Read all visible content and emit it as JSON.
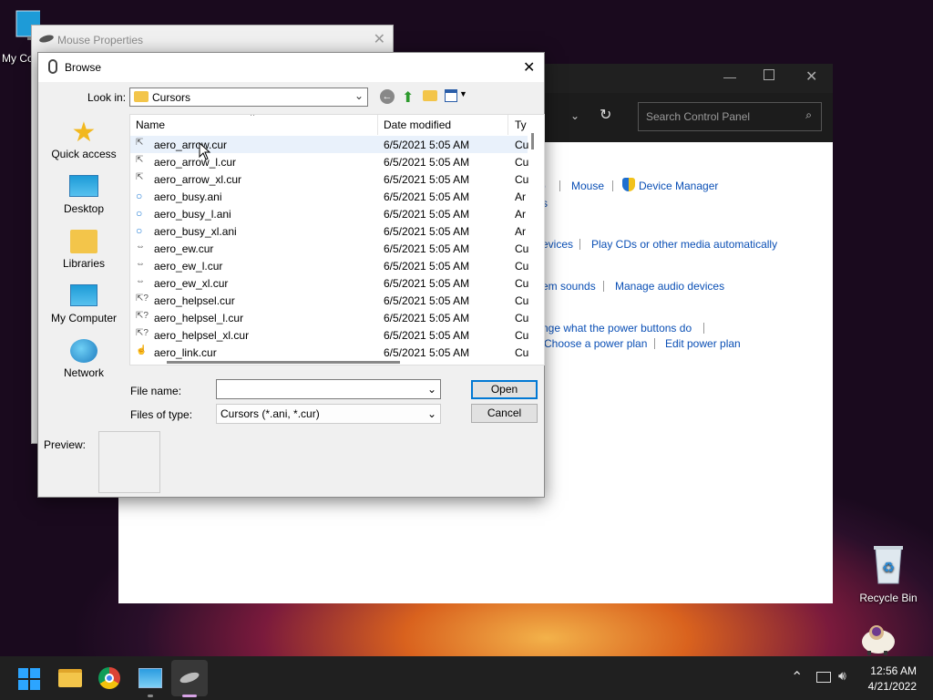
{
  "desktop": {
    "icons": [
      {
        "label": "My Co",
        "icon": "monitor-icon"
      },
      {
        "label": "Recycle Bin",
        "icon": "recycle-bin-icon"
      }
    ]
  },
  "control_panel": {
    "search_placeholder": "Search Control Panel",
    "links": {
      "p": "p",
      "mouse": "Mouse",
      "device_manager": "Device Manager",
      "s": "s",
      "evices": "evices",
      "play_cds": "Play CDs or other media automatically",
      "em_sounds": "em sounds",
      "manage_audio": "Manage audio devices",
      "power_buttons": "nge what the power buttons do",
      "choose_power_plan": "Choose a power plan",
      "edit_power_plan": "Edit power plan"
    }
  },
  "mouse_properties": {
    "title": "Mouse Properties"
  },
  "browse": {
    "title": "Browse",
    "look_in_label": "Look in:",
    "look_in_value": "Cursors",
    "places": [
      {
        "label": "Quick access",
        "icon": "star-icon"
      },
      {
        "label": "Desktop",
        "icon": "desktop-icon"
      },
      {
        "label": "Libraries",
        "icon": "libraries-icon"
      },
      {
        "label": "My Computer",
        "icon": "computer-icon"
      },
      {
        "label": "Network",
        "icon": "network-icon"
      }
    ],
    "columns": {
      "name": "Name",
      "date": "Date modified",
      "type": "Ty"
    },
    "files": [
      {
        "name": "aero_arrow.cur",
        "date": "6/5/2021 5:05 AM",
        "type": "Cu",
        "icon": "arrow-cursor-icon"
      },
      {
        "name": "aero_arrow_l.cur",
        "date": "6/5/2021 5:05 AM",
        "type": "Cu",
        "icon": "arrow-cursor-icon"
      },
      {
        "name": "aero_arrow_xl.cur",
        "date": "6/5/2021 5:05 AM",
        "type": "Cu",
        "icon": "arrow-cursor-icon"
      },
      {
        "name": "aero_busy.ani",
        "date": "6/5/2021 5:05 AM",
        "type": "Ar",
        "icon": "busy-cursor-icon"
      },
      {
        "name": "aero_busy_l.ani",
        "date": "6/5/2021 5:05 AM",
        "type": "Ar",
        "icon": "busy-cursor-icon"
      },
      {
        "name": "aero_busy_xl.ani",
        "date": "6/5/2021 5:05 AM",
        "type": "Ar",
        "icon": "busy-cursor-icon"
      },
      {
        "name": "aero_ew.cur",
        "date": "6/5/2021 5:05 AM",
        "type": "Cu",
        "icon": "ew-cursor-icon"
      },
      {
        "name": "aero_ew_l.cur",
        "date": "6/5/2021 5:05 AM",
        "type": "Cu",
        "icon": "ew-cursor-icon"
      },
      {
        "name": "aero_ew_xl.cur",
        "date": "6/5/2021 5:05 AM",
        "type": "Cu",
        "icon": "ew-cursor-icon"
      },
      {
        "name": "aero_helpsel.cur",
        "date": "6/5/2021 5:05 AM",
        "type": "Cu",
        "icon": "helpsel-cursor-icon"
      },
      {
        "name": "aero_helpsel_l.cur",
        "date": "6/5/2021 5:05 AM",
        "type": "Cu",
        "icon": "helpsel-cursor-icon"
      },
      {
        "name": "aero_helpsel_xl.cur",
        "date": "6/5/2021 5:05 AM",
        "type": "Cu",
        "icon": "helpsel-cursor-icon"
      },
      {
        "name": "aero_link.cur",
        "date": "6/5/2021 5:05 AM",
        "type": "Cu",
        "icon": "link-cursor-icon"
      }
    ],
    "file_name_label": "File name:",
    "file_name_value": "",
    "files_of_type_label": "Files of type:",
    "files_of_type_value": "Cursors (*.ani, *.cur)",
    "open_label": "Open",
    "cancel_label": "Cancel",
    "preview_label": "Preview:"
  },
  "taskbar": {
    "time": "12:56 AM",
    "date": "4/21/2022",
    "apps": [
      "start-icon",
      "file-explorer-icon",
      "chrome-icon",
      "control-panel-icon",
      "mouse-app-icon"
    ]
  },
  "colors": {
    "accent": "#0078d4",
    "link": "#0a4fb5",
    "selection": "#e9f1fb"
  }
}
